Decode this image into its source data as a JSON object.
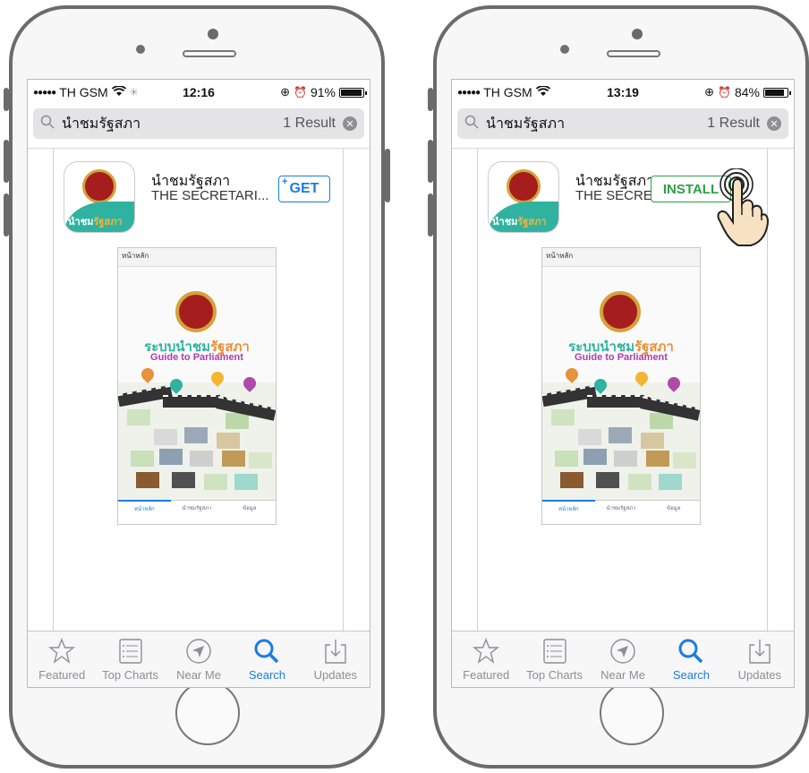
{
  "phones": [
    {
      "status": {
        "signal_dots": "●●●●●",
        "carrier": "TH GSM",
        "time": "12:16",
        "battery": "91%",
        "battery_level": 0.91
      },
      "search": {
        "query": "นำชมรัฐสภา",
        "result_count": "1 Result"
      },
      "app": {
        "name": "นำชมรัฐสภา",
        "developer": "THE SECRETARI...",
        "action_label": "GET",
        "action_plus": "+",
        "icon_label_a": "นำชม",
        "icon_label_b": "รัฐสภา"
      },
      "screenshot": {
        "header": "หน้าหลัก",
        "title_a": "ระบบนำชม",
        "title_b": "รัฐสภา",
        "subtitle": "Guide to Parliament",
        "tabs": [
          "หน้าหลัก",
          "นำชมรัฐสภา",
          "ข้อมูล"
        ]
      },
      "tabs": [
        "Featured",
        "Top Charts",
        "Near Me",
        "Search",
        "Updates"
      ]
    },
    {
      "status": {
        "signal_dots": "●●●●●",
        "carrier": "TH GSM",
        "time": "13:19",
        "battery": "84%",
        "battery_level": 0.84
      },
      "search": {
        "query": "นำชมรัฐสภา",
        "result_count": "1 Result"
      },
      "app": {
        "name": "นำชมรัฐสภา",
        "developer": "THE SECRETAR",
        "action_label": "INSTALL",
        "icon_label_a": "นำชม",
        "icon_label_b": "รัฐสภา"
      },
      "screenshot": {
        "header": "หน้าหลัก",
        "title_a": "ระบบนำชม",
        "title_b": "รัฐสภา",
        "subtitle": "Guide to Parliament",
        "tabs": [
          "หน้าหลัก",
          "นำชมรัฐสภา",
          "ข้อมูล"
        ]
      },
      "tabs": [
        "Featured",
        "Top Charts",
        "Near Me",
        "Search",
        "Updates"
      ]
    }
  ],
  "colors": {
    "accent": "#1a7de0",
    "install": "#2e9e44",
    "teal": "#2fb3a0"
  },
  "icons": [
    "search-icon",
    "clear-icon",
    "star-icon",
    "list-icon",
    "location-arrow-icon",
    "magnifier-icon",
    "download-icon",
    "wifi-icon",
    "alarm-icon",
    "lock-rotation-icon",
    "tap-hand-icon"
  ]
}
